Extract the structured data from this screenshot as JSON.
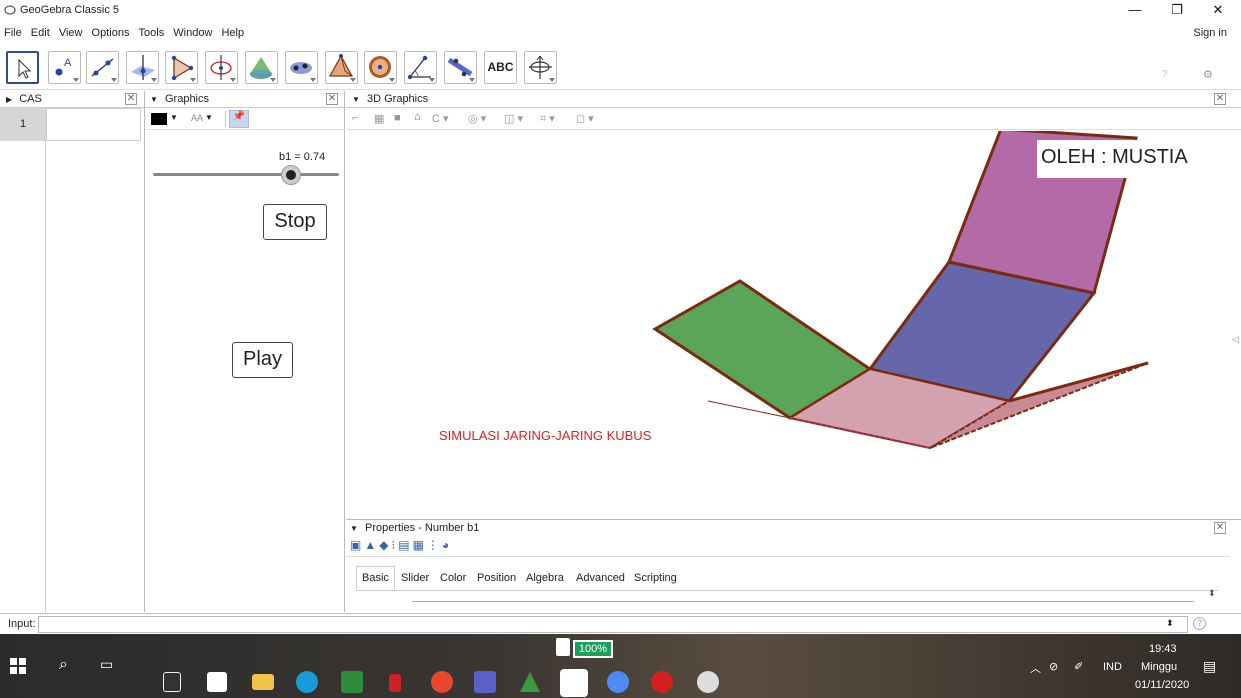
{
  "window": {
    "title": "GeoGebra Classic 5",
    "minimize": "—",
    "maximize": "❐",
    "close": "✕"
  },
  "menu": [
    "File",
    "Edit",
    "View",
    "Options",
    "Tools",
    "Window",
    "Help"
  ],
  "signin": "Sign in",
  "toolbar": {
    "tools": [
      "move-tool",
      "point-tool",
      "line-tool",
      "perpendicular-tool",
      "polygon-tool",
      "circle-tool",
      "cone-tool",
      "point-on-object-tool",
      "pyramid-tool",
      "sphere-tool",
      "angle-tool",
      "reflect-tool",
      "text-tool",
      "rotate-view-tool"
    ],
    "text_tool_label": "ABC",
    "undo": "↶",
    "redo": "↷",
    "help": "?",
    "settings": "⚙"
  },
  "cas": {
    "title": "CAS",
    "row_number": "1",
    "cell_value": ""
  },
  "graphics": {
    "title": "Graphics",
    "slider_label": "b1 = 0.74",
    "slider_value": 0.74,
    "stop_button": "Stop",
    "play_button": "Play",
    "color_swatch": "#000000",
    "text_size_label": "AA"
  },
  "view3d": {
    "title": "3D Graphics",
    "author_label": "OLEH : MUSTIA",
    "sim_label": "SIMULASI JARING-JARING KUBUS",
    "sim_label_color": "#e02020",
    "face_colors": {
      "green": "#5aa55a",
      "blue": "#6666aa",
      "magenta": "#b56aa8",
      "pink": "#d4a2ae",
      "pink_right": "#c98a95",
      "edge": "#7a2a10"
    }
  },
  "properties": {
    "title": "Properties - Number b1",
    "tabs": [
      "Basic",
      "Slider",
      "Color",
      "Position",
      "Algebra",
      "Advanced",
      "Scripting"
    ],
    "active_tab": "Basic"
  },
  "input": {
    "label": "Input:",
    "value": ""
  },
  "taskbar": {
    "battery": "100%",
    "time": "19:43",
    "day": "Minggu",
    "date": "01/11/2020",
    "lang": "IND"
  }
}
